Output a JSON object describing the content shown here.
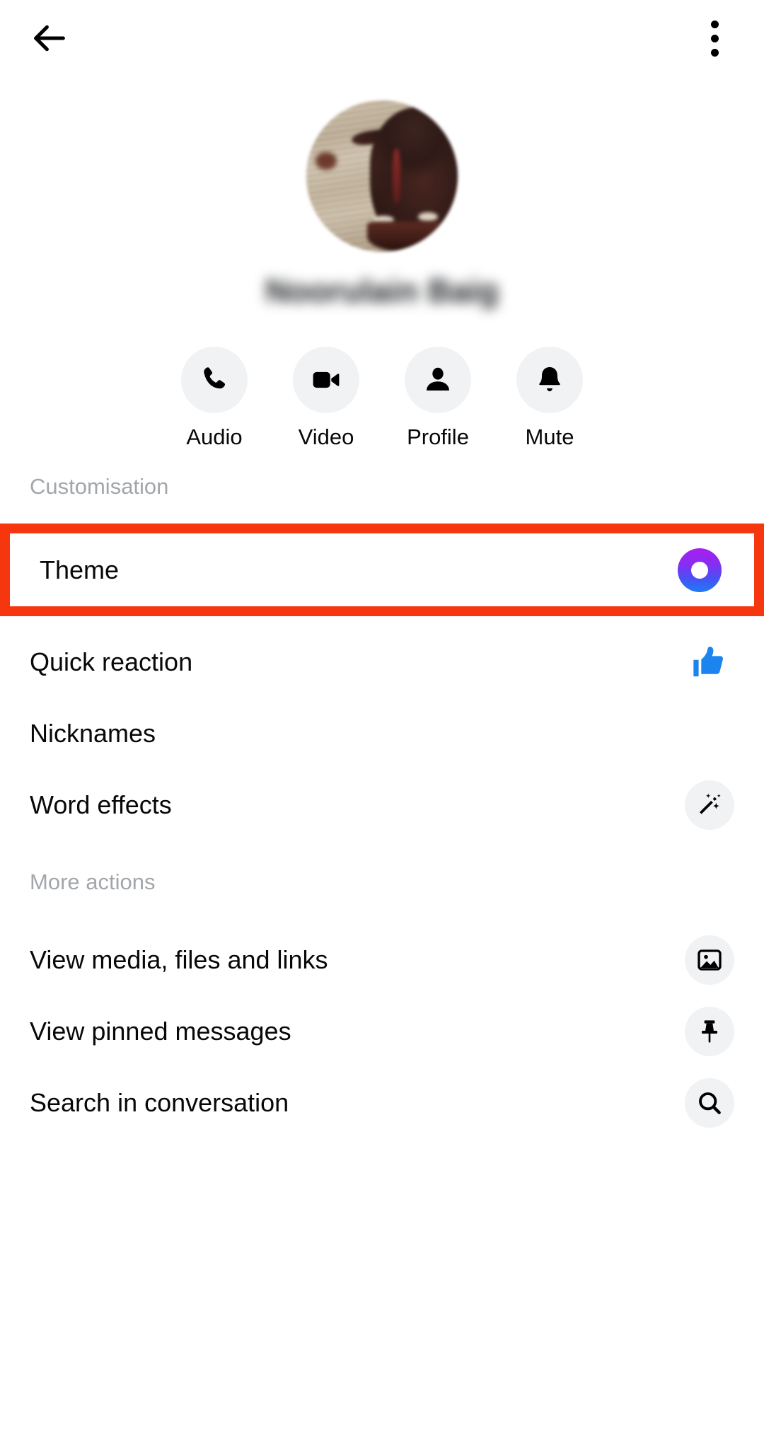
{
  "topbar": {
    "back_icon": "arrow-left-icon",
    "overflow_icon": "more-vertical-icon"
  },
  "profile": {
    "name": "Noorulain Baig",
    "avatar_alt": "blurred photo of a dark bird on sand",
    "actions": [
      {
        "label": "Audio",
        "icon": "phone-icon"
      },
      {
        "label": "Video",
        "icon": "video-camera-icon"
      },
      {
        "label": "Profile",
        "icon": "person-icon"
      },
      {
        "label": "Mute",
        "icon": "bell-icon"
      }
    ]
  },
  "sections": [
    {
      "header": "Customisation",
      "rows": [
        {
          "label": "Theme",
          "icon": "theme-gradient-swatch-icon",
          "highlighted": true
        },
        {
          "label": "Quick reaction",
          "icon": "thumbs-up-icon"
        },
        {
          "label": "Nicknames",
          "icon": "none"
        },
        {
          "label": "Word effects",
          "icon": "magic-wand-icon"
        }
      ]
    },
    {
      "header": "More actions",
      "rows": [
        {
          "label": "View media, files and links",
          "icon": "image-icon"
        },
        {
          "label": "View pinned messages",
          "icon": "pin-icon"
        },
        {
          "label": "Search in conversation",
          "icon": "search-icon"
        }
      ]
    }
  ],
  "colors": {
    "highlight_border": "#f5360e",
    "theme_gradient_start": "#a61ff0",
    "theme_gradient_end": "#1d7cf5",
    "thumbs_up_blue": "#1b84ee",
    "icon_circle_bg": "#f1f2f4",
    "section_header_text": "#a3a6aa",
    "primary_text": "#080809"
  }
}
